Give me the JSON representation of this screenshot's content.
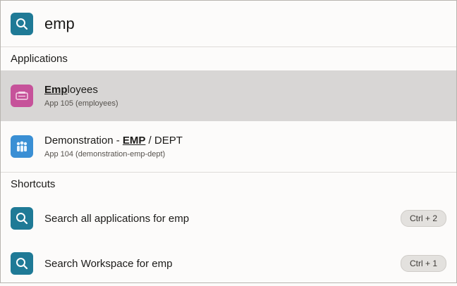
{
  "search": {
    "query": "emp"
  },
  "applications": {
    "header": "Applications",
    "items": [
      {
        "title_bold": "Emp",
        "title_rest": "loyees",
        "subtitle": "App 105 (employees)"
      },
      {
        "title_pre": "Demonstration - ",
        "title_bold": "EMP",
        "title_rest": " / DEPT",
        "subtitle": "App 104 (demonstration-emp-dept)"
      }
    ]
  },
  "shortcuts": {
    "header": "Shortcuts",
    "items": [
      {
        "label": "Search all applications for emp",
        "key": "Ctrl + 2"
      },
      {
        "label": "Search Workspace for emp",
        "key": "Ctrl + 1"
      }
    ]
  },
  "colors": {
    "accent": "#1f7a96",
    "employees_icon": "#c6529a",
    "demo_icon": "#3a8fd4",
    "selected_row": "#d8d6d5"
  }
}
